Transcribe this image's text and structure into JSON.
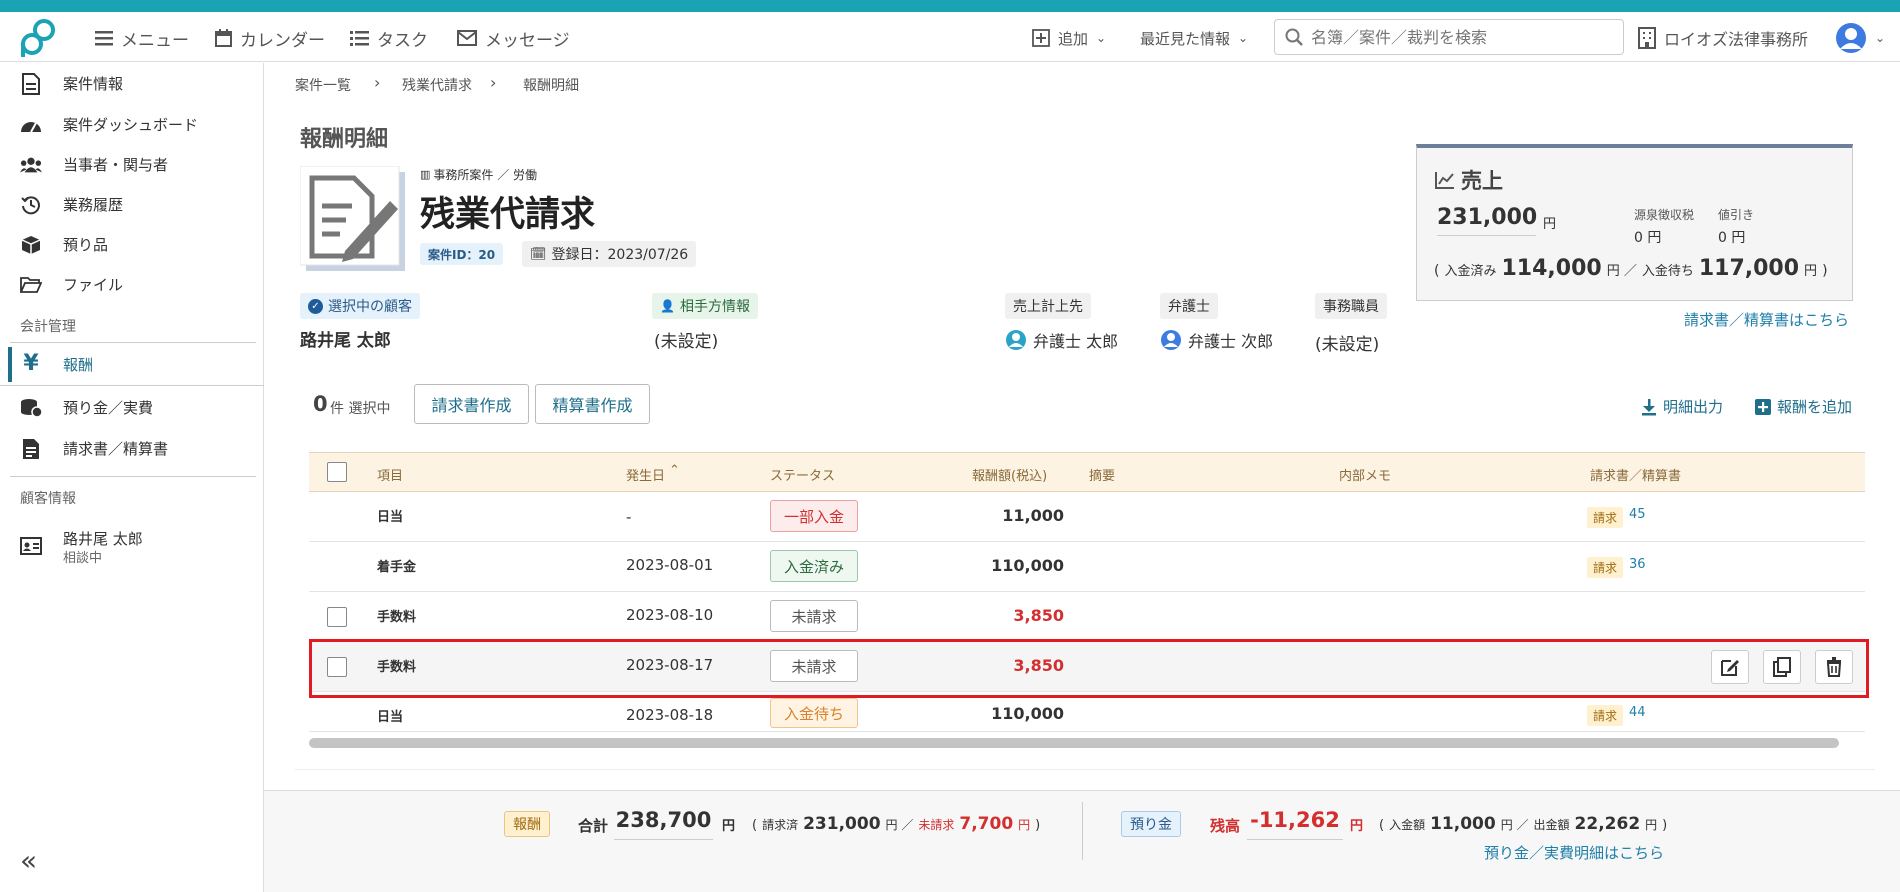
{
  "colors": {
    "accent": "#1aa3b5",
    "highlight": "#e01b24",
    "negative": "#d32f2f",
    "link": "#1f7fa8"
  },
  "topnav": {
    "menu": "メニュー",
    "calendar": "カレンダー",
    "task": "タスク",
    "message": "メッセージ",
    "add": "追加",
    "recent": "最近見た情報",
    "search_placeholder": "名簿／案件／裁判を検索",
    "office": "ロイオズ法律事務所"
  },
  "sidebar": {
    "items": [
      {
        "label": "案件情報",
        "icon": "document-icon"
      },
      {
        "label": "案件ダッシュボード",
        "icon": "dashboard-icon"
      },
      {
        "label": "当事者・関与者",
        "icon": "users-icon"
      },
      {
        "label": "業務履歴",
        "icon": "history-icon"
      },
      {
        "label": "預り品",
        "icon": "box-icon"
      },
      {
        "label": "ファイル",
        "icon": "folder-icon"
      }
    ],
    "section_accounting": "会計管理",
    "accounting_items": [
      {
        "label": "報酬",
        "icon": "yen-icon"
      },
      {
        "label": "預り金／実費",
        "icon": "coins-icon"
      },
      {
        "label": "請求書／精算書",
        "icon": "invoice-icon"
      }
    ],
    "section_customer": "顧客情報",
    "customer": {
      "name": "路井尾 太郎",
      "status": "相談中"
    },
    "collapse": "«"
  },
  "breadcrumb": [
    "案件一覧",
    "残業代請求",
    "報酬明細"
  ],
  "page_title": "報酬明細",
  "case": {
    "category": "事務所案件 ／ 労働",
    "title": "残業代請求",
    "id_label": "案件ID：20",
    "registered": "登録日：2023/07/26"
  },
  "parties": {
    "client_label": "選択中の顧客",
    "client_name": "路井尾 太郎",
    "opponent_label": "相手方情報",
    "opponent_value": "(未設定)",
    "sales_dest_label": "売上計上先",
    "sales_dest_value": "弁護士 太郎",
    "lawyer_label": "弁護士",
    "lawyer_value": "弁護士 次郎",
    "staff_label": "事務職員",
    "staff_value": "(未設定)"
  },
  "sales": {
    "title": "売上",
    "amount": "231,000",
    "yen": "円",
    "withholding_label": "源泉徴収税",
    "withholding_value": "0 円",
    "discount_label": "値引き",
    "discount_value": "0 円",
    "paid_label": "入金済み",
    "paid_value": "114,000",
    "waiting_label": "入金待ち",
    "waiting_value": "117,000",
    "open_paren": "(",
    "close_paren": ")",
    "sep": "円 ／",
    "yen_close": "円",
    "link": "請求書／精算書はこちら"
  },
  "toolbar": {
    "selected_count": "0",
    "selected_suffix": "件 選択中",
    "create_invoice": "請求書作成",
    "create_settlement": "精算書作成",
    "export": "明細出力",
    "add_fee": "報酬を追加"
  },
  "table": {
    "headers": [
      "項目",
      "発生日",
      "ステータス",
      "報酬額(税込)",
      "摘要",
      "内部メモ",
      "請求書／精算書"
    ],
    "rows": [
      {
        "item": "日当",
        "date": "-",
        "status": "一部入金",
        "amount": "11,000",
        "invoice_tag": "請求",
        "invoice_no": "45"
      },
      {
        "item": "着手金",
        "date": "2023-08-01",
        "status": "入金済み",
        "amount": "110,000",
        "invoice_tag": "請求",
        "invoice_no": "36"
      },
      {
        "item": "手数料",
        "date": "2023-08-10",
        "status": "未請求",
        "amount": "3,850",
        "invoice_tag": "",
        "invoice_no": ""
      },
      {
        "item": "手数料",
        "date": "2023-08-17",
        "status": "未請求",
        "amount": "3,850",
        "invoice_tag": "",
        "invoice_no": ""
      },
      {
        "item": "日当",
        "date": "2023-08-18",
        "status": "入金待ち",
        "amount": "110,000",
        "invoice_tag": "請求",
        "invoice_no": "44"
      }
    ]
  },
  "footer": {
    "fee_tag": "報酬",
    "total_label": "合計",
    "total_value": "238,700",
    "yen": "円",
    "billed_label": "請求済",
    "billed_value": "231,000",
    "unbilled_label": "未請求",
    "unbilled_value": "7,700",
    "deposit_tag": "預り金",
    "balance_label": "残高",
    "balance_value": "-11,262",
    "in_label": "入金額",
    "in_value": "11,000",
    "out_label": "出金額",
    "out_value": "22,262",
    "deposit_link": "預り金／実費明細はこちら",
    "open_paren": "(",
    "close_paren": ")",
    "sep": "円 ／",
    "yen_close": "円"
  }
}
